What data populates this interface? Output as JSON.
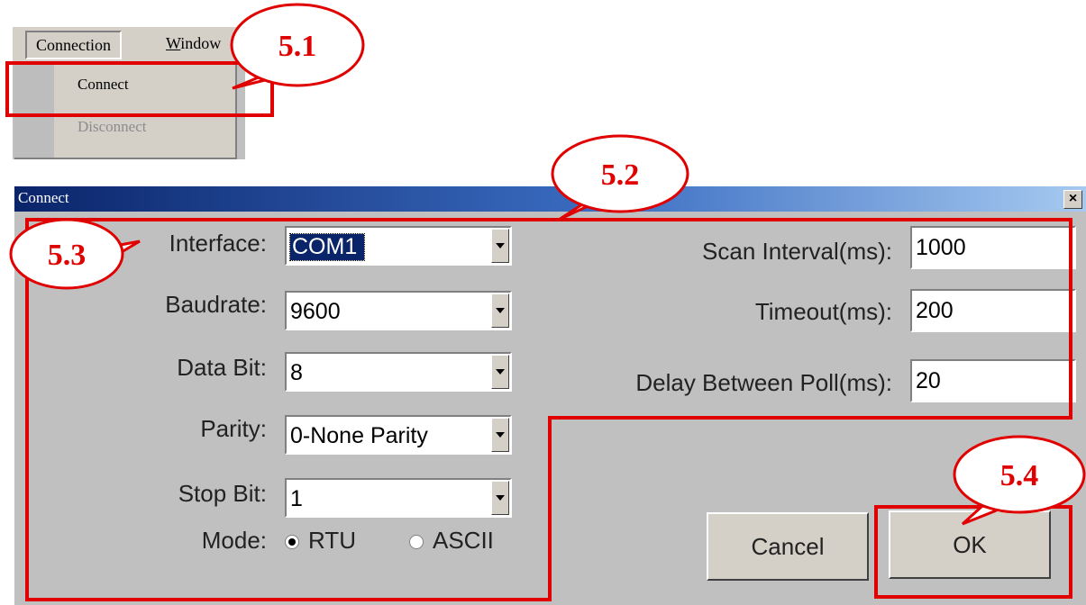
{
  "menu": {
    "active_title": "Connection",
    "other_title_u": "W",
    "other_title_rest": "indow",
    "items": [
      {
        "label": "Connect",
        "enabled": true
      },
      {
        "label": "Disconnect",
        "enabled": false
      }
    ]
  },
  "dialog": {
    "title": "Connect",
    "close": "×",
    "left_labels": {
      "interface": "Interface:",
      "baudrate": "Baudrate:",
      "data_bit": "Data Bit:",
      "parity": "Parity:",
      "stop_bit": "Stop Bit:",
      "mode": "Mode:"
    },
    "combos": {
      "interface": "COM1",
      "baudrate": "9600",
      "data_bit": "8",
      "parity": "0-None Parity",
      "stop_bit": "1"
    },
    "mode_options": {
      "rtu": "RTU",
      "ascii": "ASCII",
      "selected": "RTU"
    },
    "right_labels": {
      "scan_interval": "Scan Interval(ms):",
      "timeout": "Timeout(ms):",
      "delay": "Delay Between Poll(ms):"
    },
    "fields": {
      "scan_interval": "1000",
      "timeout": "200",
      "delay": "20"
    },
    "buttons": {
      "cancel": "Cancel",
      "ok": "OK"
    }
  },
  "annotations": {
    "c51": "5.1",
    "c52": "5.2",
    "c53": "5.3",
    "c54": "5.4",
    "color": "#e00000"
  }
}
